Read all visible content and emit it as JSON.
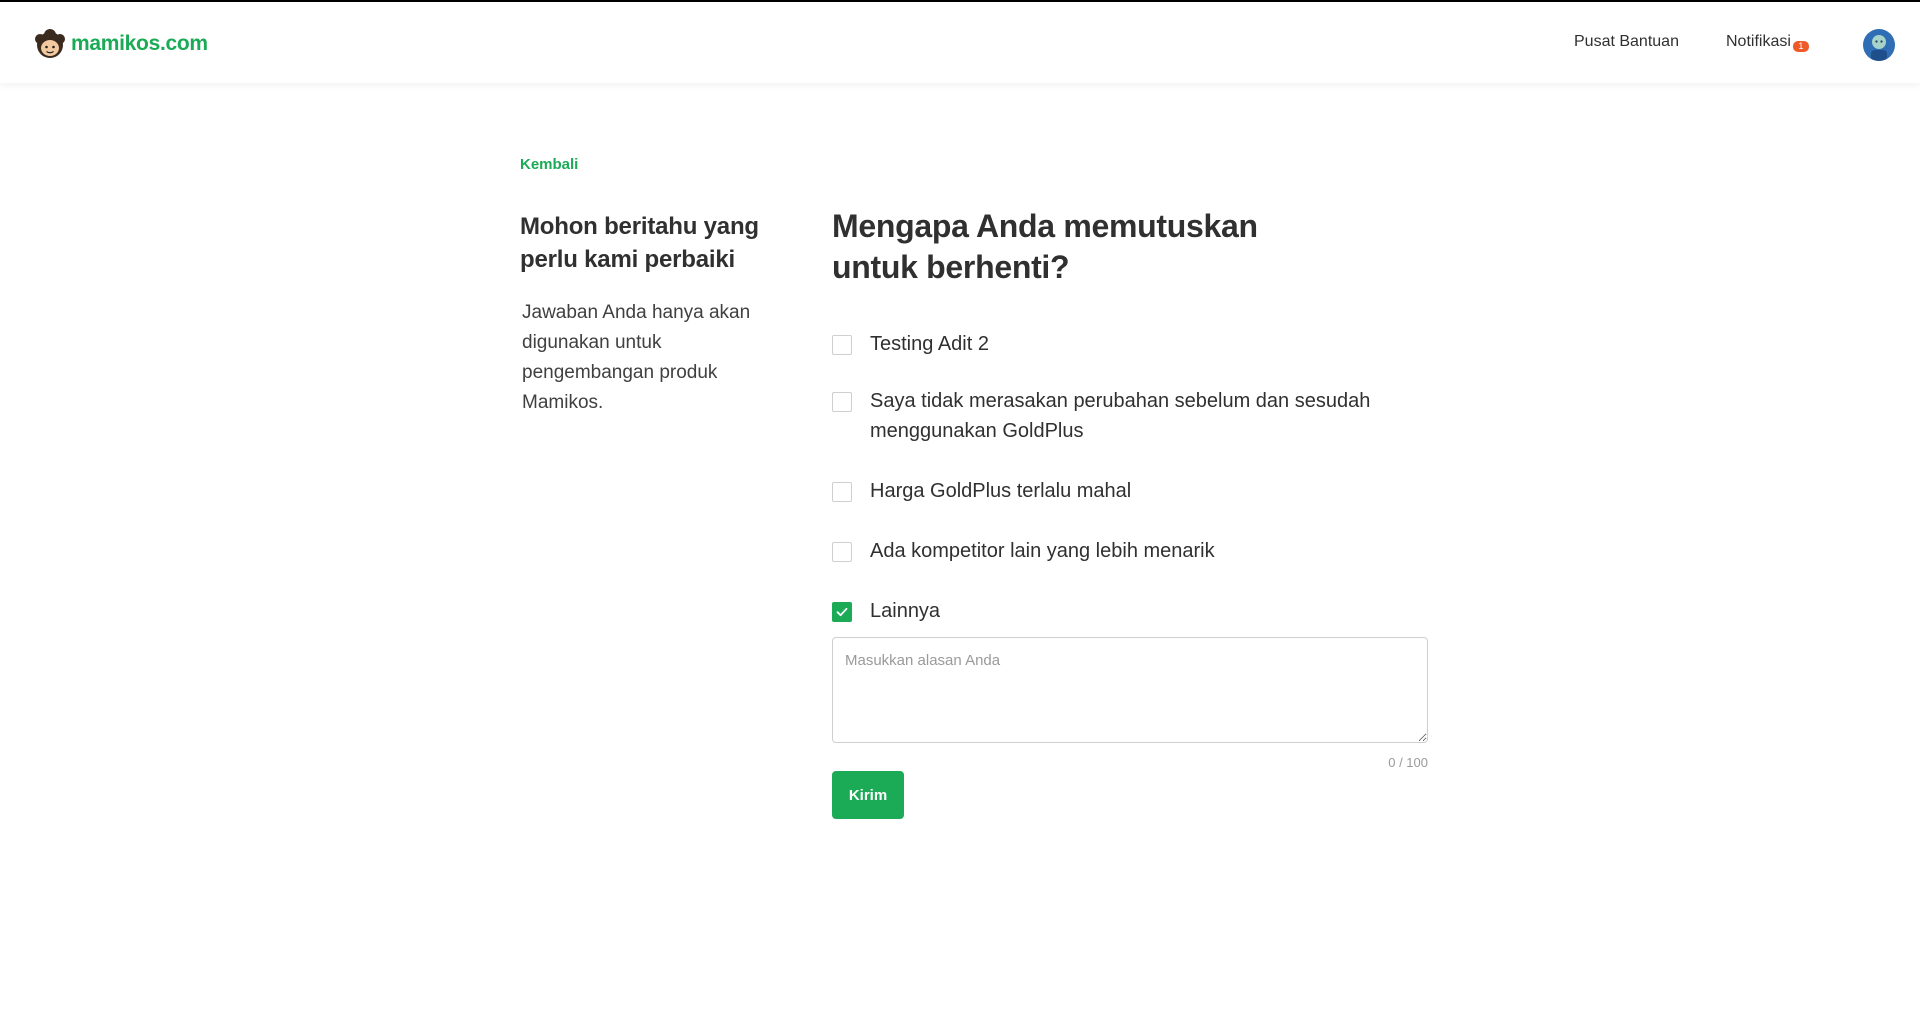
{
  "header": {
    "brand": "mamikos.com",
    "help_link": "Pusat Bantuan",
    "notif_link": "Notifikasi",
    "notif_count": "1",
    "colors": {
      "brand": "#1baa56",
      "badge": "#ef5a2a"
    }
  },
  "back_link": "Kembali",
  "sidebar": {
    "title": "Mohon beritahu yang perlu kami perbaiki",
    "description": "Jawaban Anda hanya akan digunakan untuk pengembangan produk Mamikos."
  },
  "form": {
    "title": "Mengapa Anda memutuskan untuk berhenti?",
    "options": [
      {
        "label": "Testing Adit 2",
        "checked": false
      },
      {
        "label": "Saya tidak merasakan perubahan sebelum dan sesudah menggunakan GoldPlus",
        "checked": false
      },
      {
        "label": "Harga GoldPlus terlalu mahal",
        "checked": false
      },
      {
        "label": "Ada kompetitor lain yang lebih menarik",
        "checked": false
      },
      {
        "label": "Lainnya",
        "checked": true
      }
    ],
    "reason_placeholder": "Masukkan alasan Anda",
    "reason_value": "",
    "counter": "0 / 100",
    "submit_label": "Kirim"
  }
}
